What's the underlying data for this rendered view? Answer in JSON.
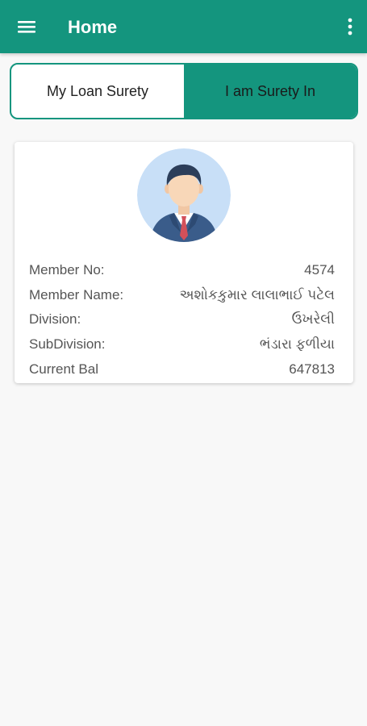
{
  "appbar": {
    "title": "Home",
    "menu_icon": "hamburger-menu-icon",
    "overflow_icon": "more-vertical-icon",
    "color": "#14957e"
  },
  "tabs": [
    {
      "label": "My Loan Surety",
      "active": false
    },
    {
      "label": "I am Surety In",
      "active": true
    }
  ],
  "member": {
    "avatar_icon": "businessman-avatar-icon",
    "rows": [
      {
        "label": "Member No:",
        "value": "4574"
      },
      {
        "label": "Member Name:",
        "value": "અશોકકુમાર લાલાભાઈ પટેલ"
      },
      {
        "label": "Division:",
        "value": "ઉખરેલી"
      },
      {
        "label": "SubDivision:",
        "value": "ભંડારા ફળીયા"
      },
      {
        "label": "Current Bal",
        "value": "647813"
      }
    ]
  }
}
